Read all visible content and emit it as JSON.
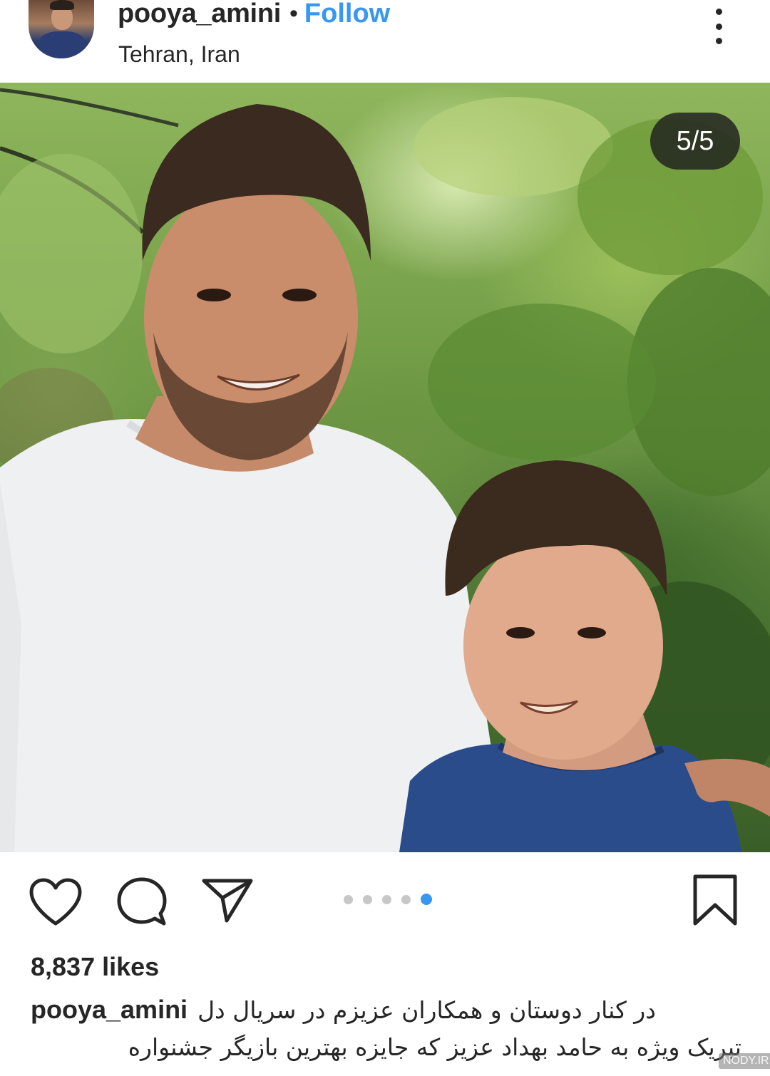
{
  "header": {
    "username": "pooya_amini",
    "separator": "•",
    "follow_label": "Follow",
    "location": "Tehran, Iran"
  },
  "photo": {
    "counter": "5/5"
  },
  "carousel": {
    "total": 5,
    "active_index": 5
  },
  "actions": {
    "like_icon": "heart-icon",
    "comment_icon": "comment-icon",
    "share_icon": "send-icon",
    "save_icon": "bookmark-icon"
  },
  "post": {
    "likes": "8,837 likes",
    "caption_user": "pooya_amini",
    "caption_line1": "در کنار دوستان و همکاران عزیزم در سریال دل",
    "caption_line2": "تبریک ویژه به حامد بهداد عزیز که جایزه بهترین بازیگر جشنواره"
  },
  "watermark": "NODY.IR",
  "colors": {
    "accent": "#3897f0",
    "text": "#262626",
    "inactive_dot": "#c7c7c7"
  }
}
